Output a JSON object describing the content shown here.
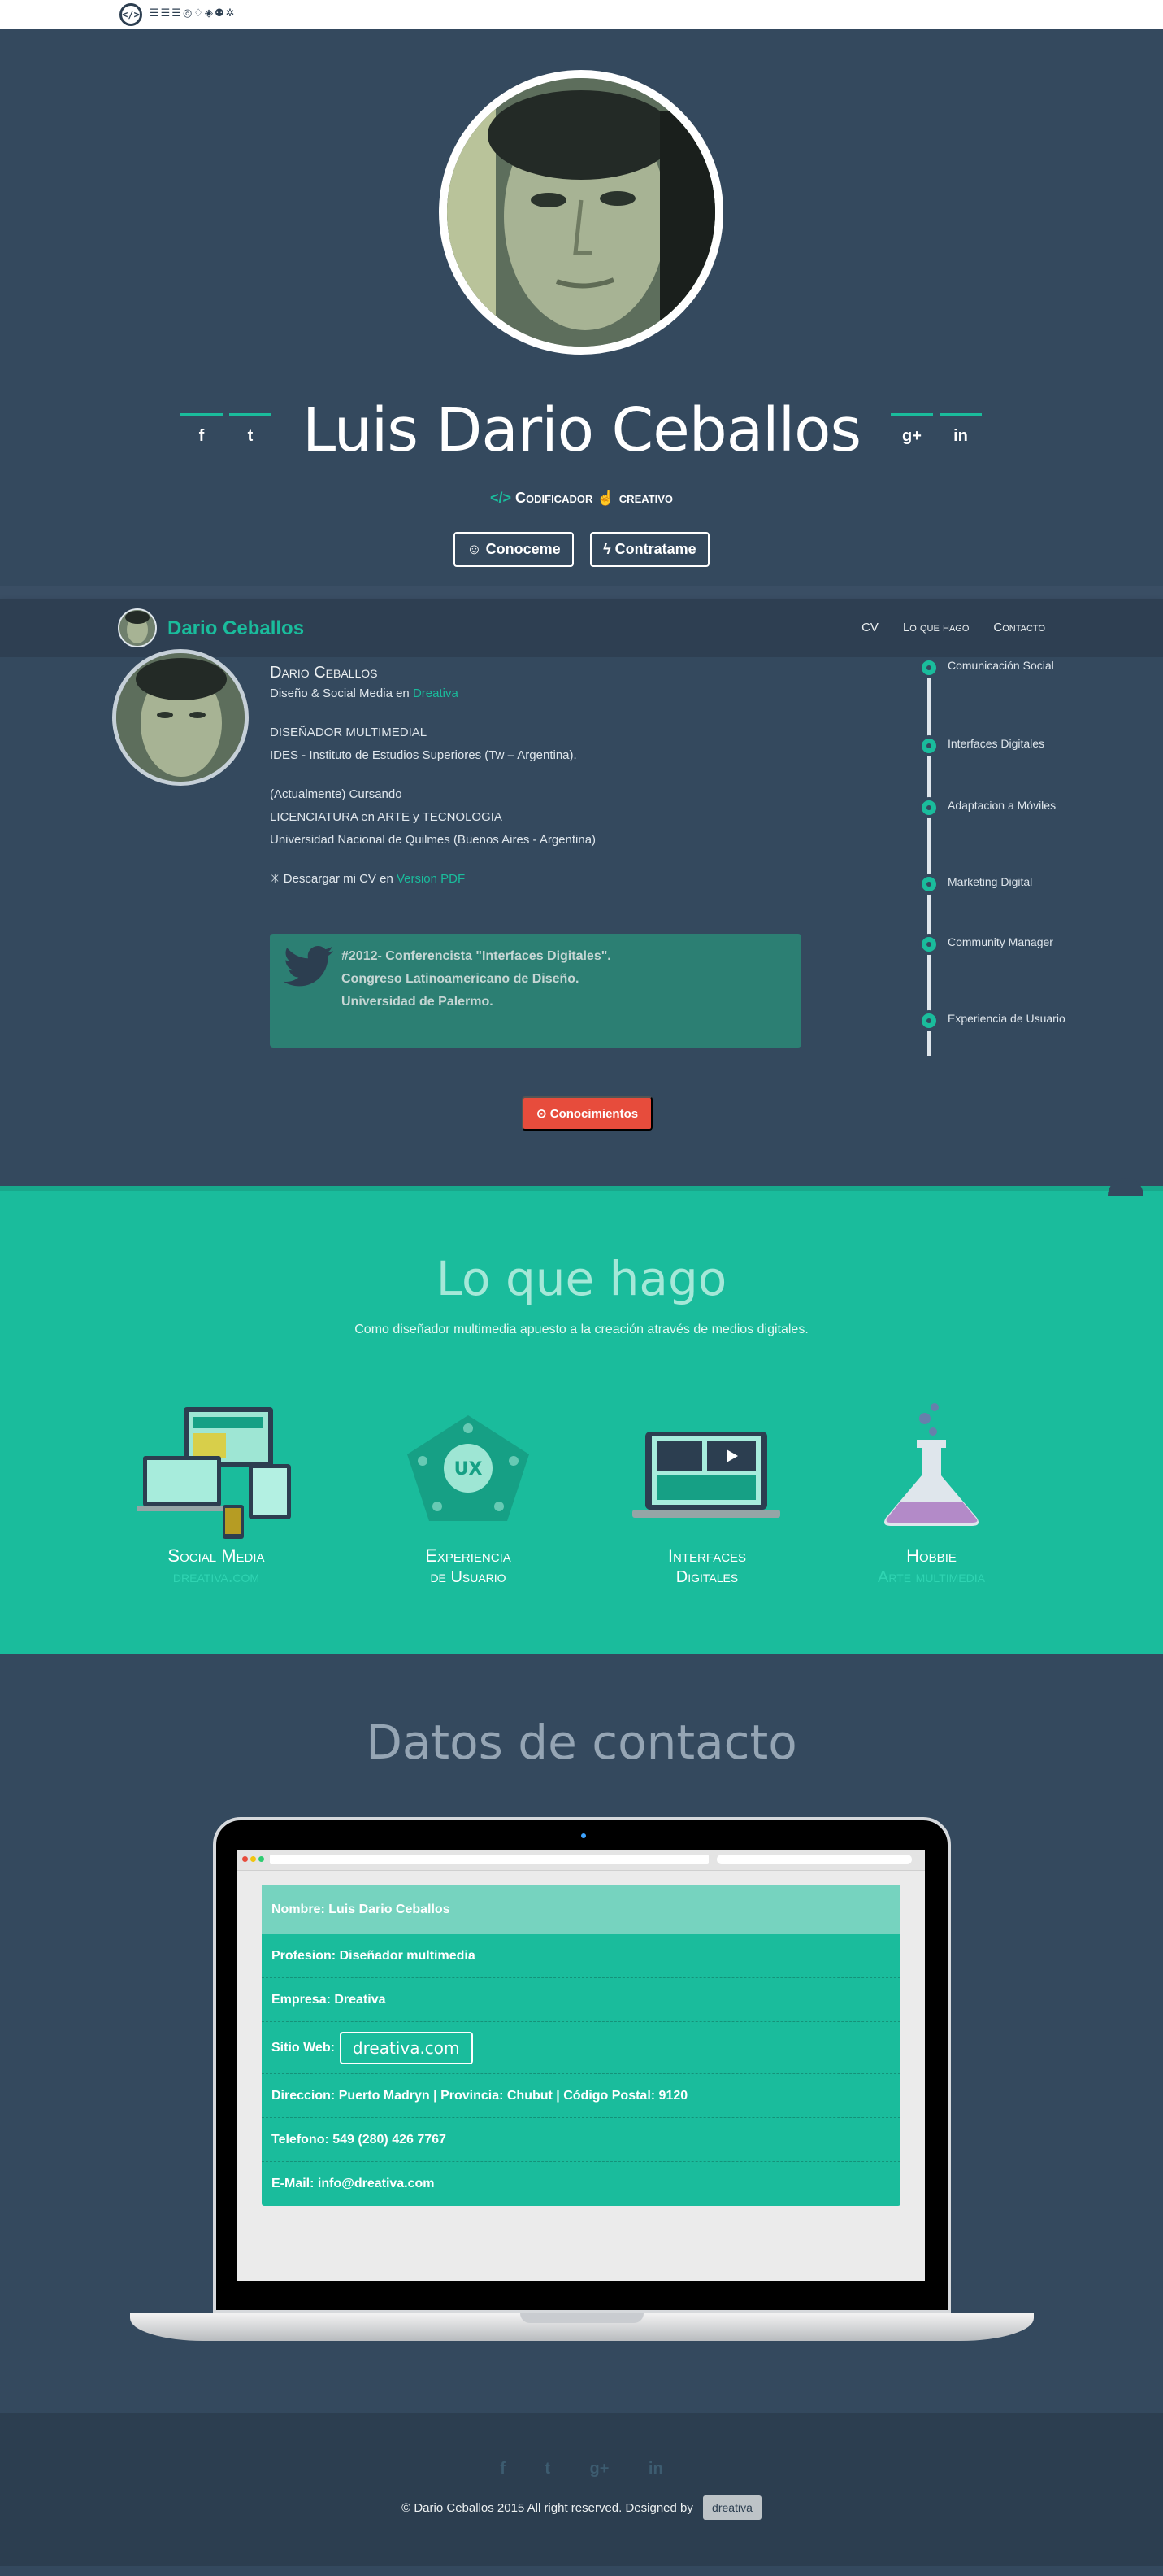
{
  "topstrip": {
    "logo_glyph": "</>",
    "icons_text": "☰☰☰◎♢◈⚉✲"
  },
  "hero": {
    "name": "Luis Dario Ceballos",
    "role_prefix": "</>",
    "role_word1": "Codificador",
    "role_icon": "☝",
    "role_word2": "creativo",
    "social_left": [
      "f",
      "t"
    ],
    "social_right": [
      "g+",
      "in"
    ],
    "btn_about": "☺ Conoceme",
    "btn_hire": "ϟ Contratame"
  },
  "navbar": {
    "brand": "Dario Ceballos",
    "links": [
      "CV",
      "Lo que hago",
      "Contacto"
    ]
  },
  "about": {
    "name": "Dario Ceballos",
    "tagline": "Diseño & Social Media en",
    "tagline_link": "Dreativa",
    "title": "DISEÑADOR MULTIMEDIAL",
    "institute": "IDES - Instituto de Estudios Superiores (Tw – Argentina).",
    "current": "(Actualmente) Cursando",
    "degree": "LICENCIATURA en ARTE y TECNOLOGIA",
    "university": "Universidad Nacional de Quilmes (Buenos Aires - Argentina)",
    "cv_prefix": "✳ Descargar mi CV en",
    "cv_link": "Version PDF",
    "tweet": [
      "#2012- Conferencista \"Interfaces Digitales\".",
      "Congreso Latinoamericano de Diseño.",
      "Universidad de Palermo."
    ],
    "skills_button": "⊙ Conocimientos",
    "timeline": [
      "Comunicación Social",
      "Interfaces Digitales",
      "Adaptacion a Móviles",
      "Marketing Digital",
      "Community Manager",
      "Experiencia de Usuario"
    ]
  },
  "services": {
    "title": "Lo que hago",
    "subtitle": "Como diseñador multimedia apuesto a la creación através de medios digitales.",
    "items": [
      {
        "line1": "Social Media",
        "line2": "dreativa.com",
        "faded": true
      },
      {
        "line1": "Experiencia",
        "line2": "de Usuario",
        "faded": false
      },
      {
        "line1": "Interfaces",
        "line2": "Digitales",
        "faded": false
      },
      {
        "line1": "Hobbie",
        "line2": "Arte multimedia",
        "faded": true
      }
    ],
    "ux_label": "UX"
  },
  "contact": {
    "title": "Datos de contacto",
    "nombre": "Nombre: Luis Dario Ceballos",
    "profesion": "Profesion: Diseñador multimedia",
    "empresa": "Empresa: Dreativa",
    "sitio_label": "Sitio Web:",
    "sitio": "dreativa.com",
    "direccion": "Direccion: Puerto Madryn | Provincia: Chubut | Código Postal: 9120",
    "telefono": "Telefono: 549 (280) 426 7767",
    "email": "E-Mail: info@dreativa.com"
  },
  "footer": {
    "icons": [
      "f",
      "t",
      "g+",
      "in"
    ],
    "copyright": "© Dario Ceballos 2015 All right reserved. Designed by",
    "badge": "dreativa"
  },
  "colors": {
    "accent": "#1abc9c",
    "background": "#34495e",
    "dark": "#2c3e50",
    "red": "#e74c3c"
  }
}
